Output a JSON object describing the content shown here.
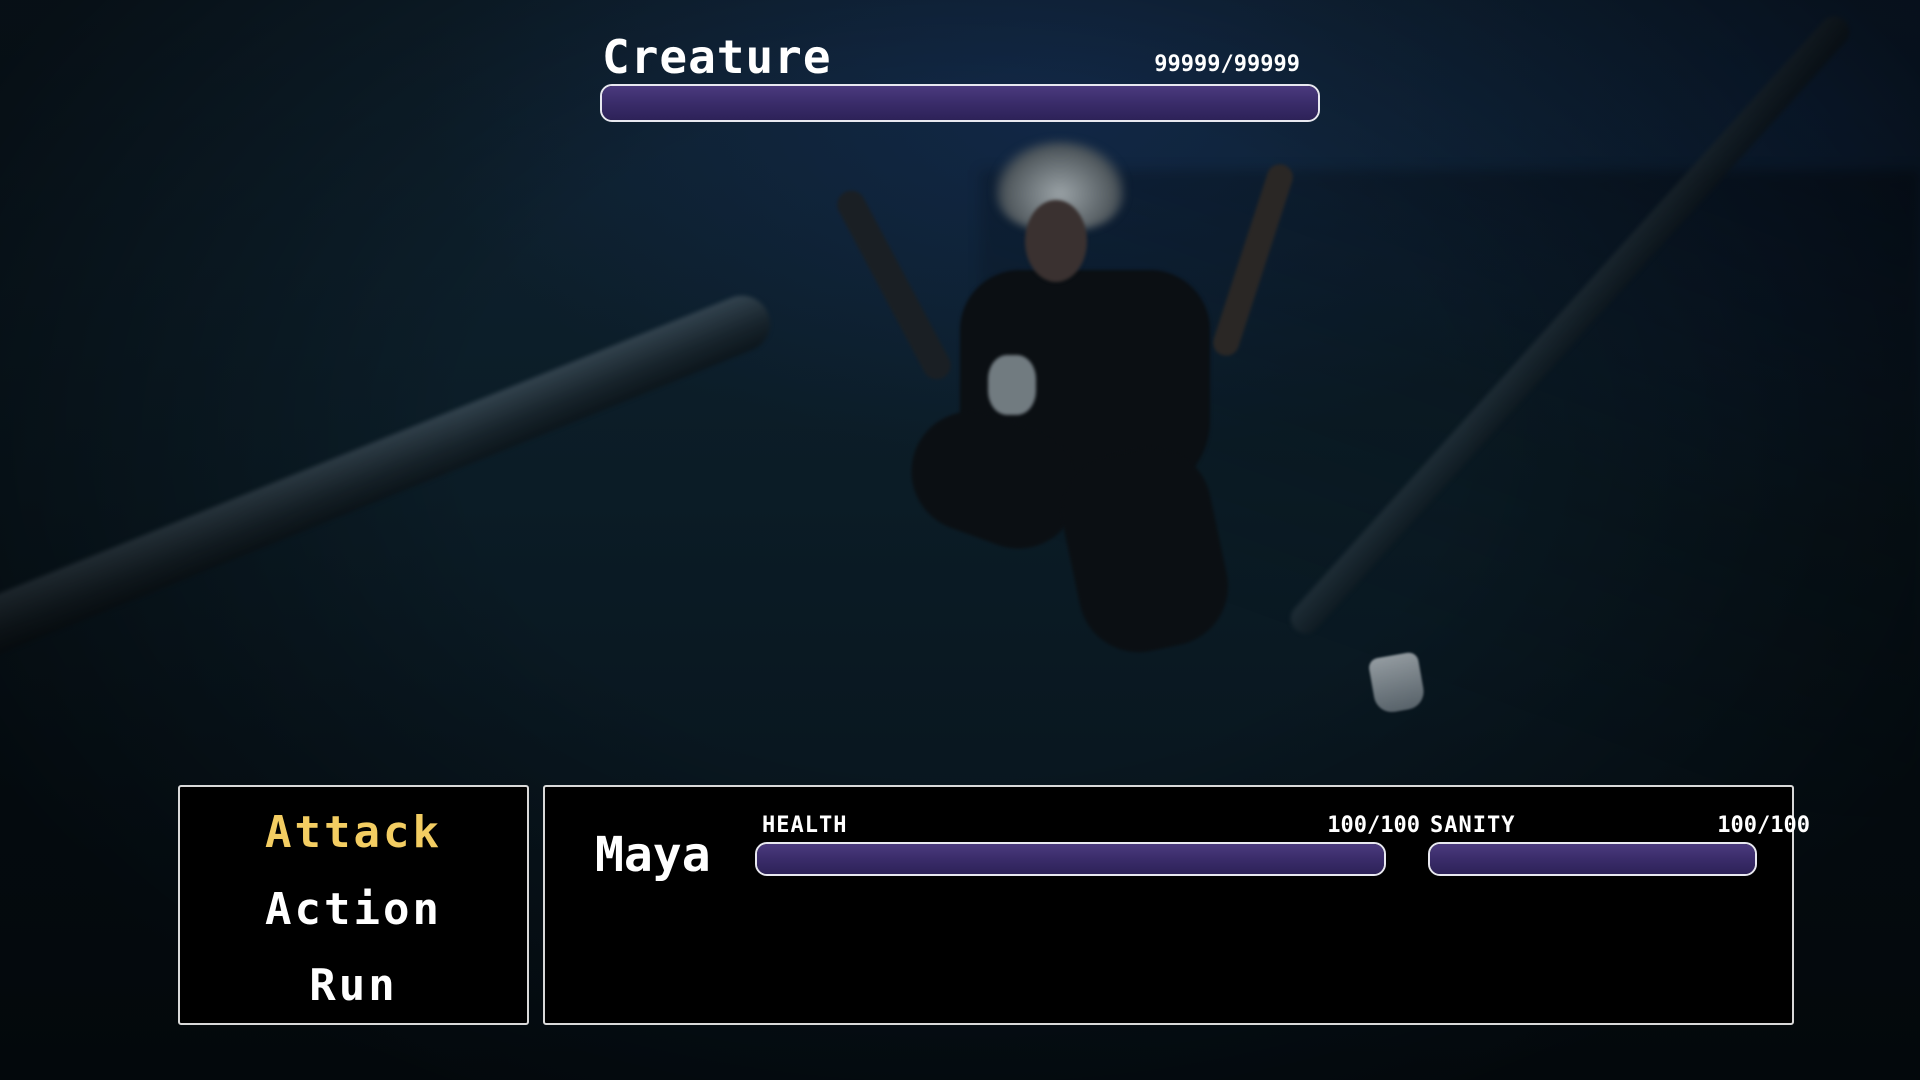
{
  "enemy": {
    "name": "Creature",
    "hp_text": "99999/99999",
    "hp_fraction": 1.0
  },
  "commands": [
    {
      "label": "Attack",
      "selected": true
    },
    {
      "label": "Action",
      "selected": false
    },
    {
      "label": "Run",
      "selected": false
    }
  ],
  "party": {
    "name": "Maya",
    "health": {
      "label": "HEALTH",
      "value_text": "100/100",
      "fraction": 1.0
    },
    "sanity": {
      "label": "SANITY",
      "value_text": "100/100",
      "fraction": 1.0
    }
  },
  "colors": {
    "selected_command": "#f3cd62",
    "bar_fill": "#3a2c6a",
    "panel_border": "#d9d9d9"
  }
}
